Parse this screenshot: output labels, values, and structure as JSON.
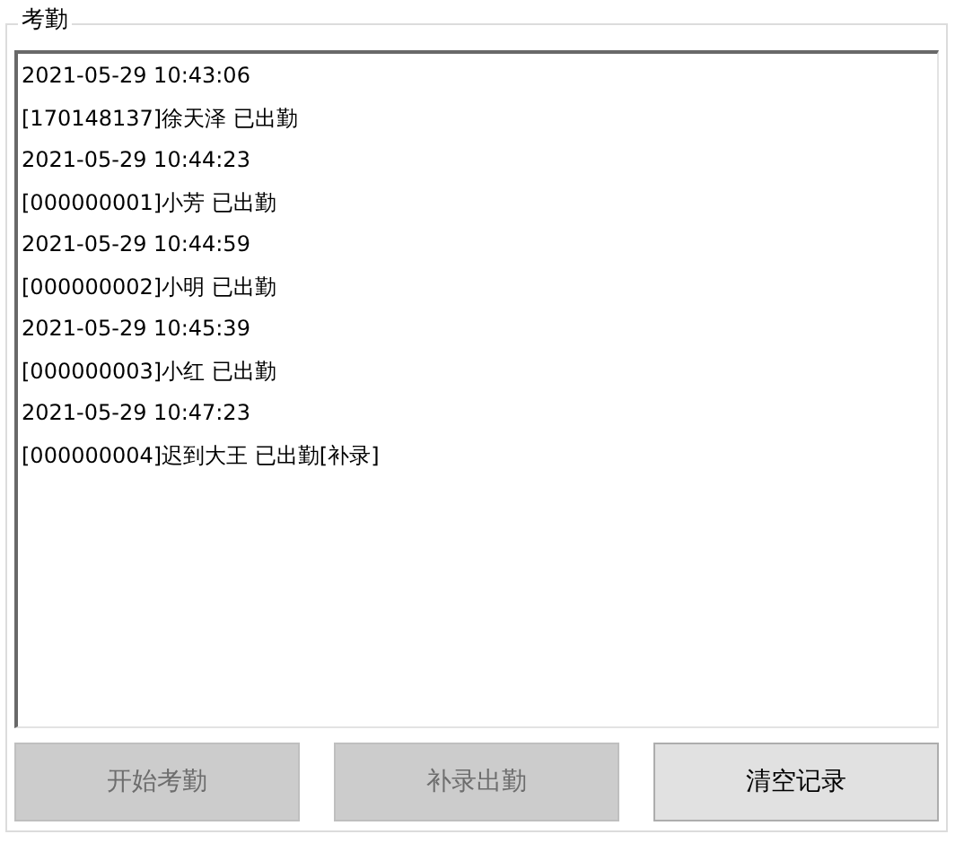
{
  "group": {
    "title": "考勤"
  },
  "log_lines": [
    "2021-05-29 10:43:06",
    "[170148137]徐天泽 已出勤",
    "2021-05-29 10:44:23",
    "[000000001]小芳 已出勤",
    "2021-05-29 10:44:59",
    "[000000002]小明 已出勤",
    "2021-05-29 10:45:39",
    "[000000003]小红 已出勤",
    "2021-05-29 10:47:23",
    "[000000004]迟到大王 已出勤[补录]"
  ],
  "buttons": [
    {
      "label": "开始考勤",
      "disabled": true
    },
    {
      "label": "补录出勤",
      "disabled": true
    },
    {
      "label": "清空记录",
      "disabled": false
    }
  ]
}
